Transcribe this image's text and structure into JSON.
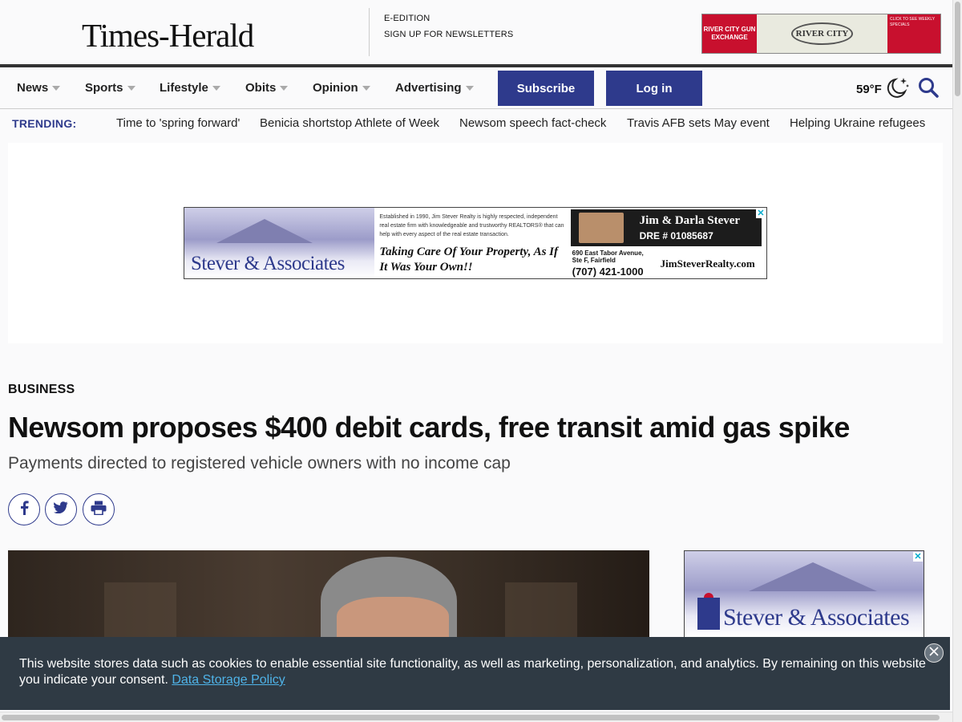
{
  "header": {
    "logo": "Times-Herald",
    "links": [
      "E-EDITION",
      "SIGN UP FOR NEWSLETTERS"
    ],
    "top_ad": {
      "left_label": "RIVER CITY GUN EXCHANGE",
      "center_label": "RIVER CITY",
      "right_label": "CLICK TO SEE WEEKLY SPECIALS"
    }
  },
  "nav": {
    "items": [
      "News",
      "Sports",
      "Lifestyle",
      "Obits",
      "Opinion",
      "Advertising"
    ],
    "subscribe": "Subscribe",
    "login": "Log in",
    "temperature": "59°F"
  },
  "trending": {
    "label": "TRENDING:",
    "links": [
      "Time to 'spring forward'",
      "Benicia shortstop Athlete of Week",
      "Newsom speech fact-check",
      "Travis AFB sets May event",
      "Helping Ukraine refugees"
    ]
  },
  "banner_ad": {
    "brand": "Stever & Associates",
    "blurb": "Established in 1990, Jim Stever Realty is highly respected, independent real estate firm with knowledgeable and trustworthy REALTORS® that can help with every aspect of the real estate transaction.",
    "slogan": "Taking Care Of Your Property, As If It Was Your Own!!",
    "names": "Jim & Darla Stever",
    "dre": "DRE # 01085687",
    "address": "690 East Tabor Avenue, Ste F, Fairfield",
    "phone": "(707) 421-1000",
    "website": "JimSteverRealty.com"
  },
  "article": {
    "section": "BUSINESS",
    "headline": "Newsom proposes $400 debit cards, free transit amid gas spike",
    "subhead": "Payments directed to registered vehicle owners with no income cap"
  },
  "side_ad": {
    "brand": "Stever & Associates"
  },
  "cookie": {
    "text": "This website stores data such as cookies to enable essential site functionality, as well as marketing, personalization, and analytics. By remaining on this website you indicate your consent.",
    "link": "Data Storage Policy"
  },
  "colors": {
    "brand_blue": "#2e3a8c",
    "cookie_bg": "#2f3a44",
    "link_blue": "#4fb3e8"
  }
}
